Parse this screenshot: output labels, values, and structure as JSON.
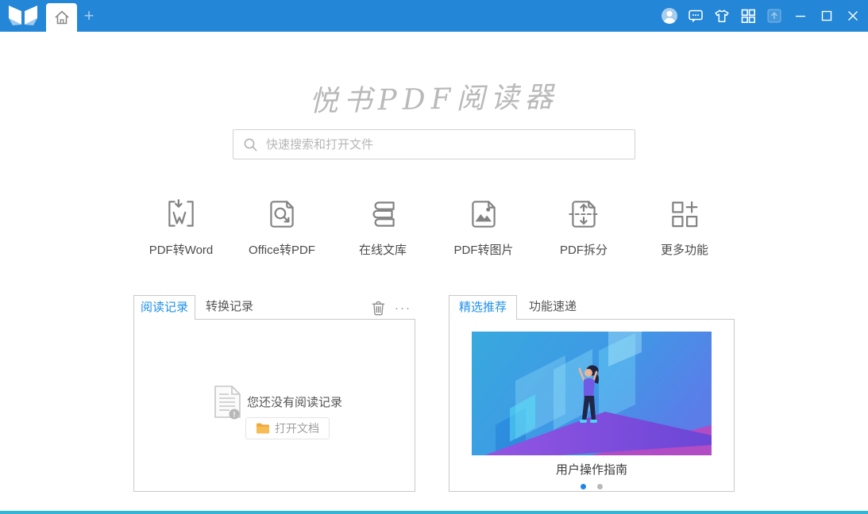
{
  "titlebar": {
    "new_tab_label": "+",
    "icon_names": [
      "app-logo-icon",
      "home-icon",
      "avatar",
      "feedback-chat-icon",
      "theme-tshirt-icon",
      "apps-grid-icon",
      "upload-icon",
      "minimize-icon",
      "maximize-icon",
      "close-icon"
    ]
  },
  "hero": {
    "app_title": "悦书PDF阅读器",
    "search_placeholder": "快速搜索和打开文件"
  },
  "features": [
    {
      "label": "PDF转Word",
      "icon": "pdf-to-word-icon"
    },
    {
      "label": "Office转PDF",
      "icon": "office-to-pdf-icon"
    },
    {
      "label": "在线文库",
      "icon": "online-library-icon"
    },
    {
      "label": "PDF转图片",
      "icon": "pdf-to-image-icon"
    },
    {
      "label": "PDF拆分",
      "icon": "pdf-split-icon"
    },
    {
      "label": "更多功能",
      "icon": "more-features-icon"
    }
  ],
  "records_panel": {
    "tab_reading": "阅读记录",
    "tab_convert": "转换记录",
    "more_label": "···",
    "empty_text": "您还没有阅读记录",
    "open_button": "打开文档"
  },
  "promo_panel": {
    "tab_featured": "精选推荐",
    "tab_updates": "功能速递",
    "caption": "用户操作指南",
    "dots": {
      "count": 2,
      "active_index": 0
    }
  },
  "colors": {
    "titlebar_bg": "#2386d7",
    "accent_blue": "#2090e8",
    "bottom_bar": "#2fb6d8",
    "folder_orange": "#f2a93b",
    "title_gray": "#b9b9b9"
  }
}
